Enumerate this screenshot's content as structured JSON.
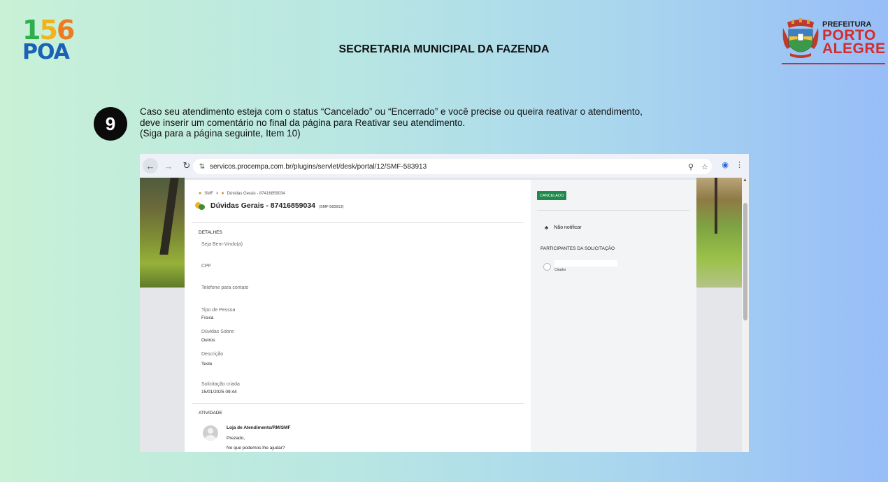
{
  "header": {
    "logo_156": {
      "digits": [
        "1",
        "5",
        "6"
      ],
      "bottom": "POA",
      "colors": [
        "#2fae4e",
        "#f2b21b",
        "#ee7b22",
        "#1a62b8"
      ]
    },
    "title": "SECRETARIA MUNICIPAL DA FAZENDA",
    "prefeitura": {
      "line1": "PREFEITURA",
      "line2": "PORTO",
      "line3": "ALEGRE",
      "accent": "#d22c2c",
      "crest_icon": "city-crest-icon"
    }
  },
  "step": {
    "number": "9",
    "lines": [
      "Caso seu atendimento esteja com o status “Cancelado” ou “Encerrado” e você precise ou queira reativar o atendimento,",
      "deve inserir um comentário no final da página para Reativar seu atendimento.",
      "(Siga para a página seguinte, Item 10)"
    ]
  },
  "browser": {
    "url": "servicos.procempa.com.br/plugins/servlet/desk/portal/12/SMF-583913",
    "icons": [
      "back-arrow-icon",
      "forward-arrow-icon",
      "reload-icon",
      "site-settings-icon",
      "zoom-icon",
      "star-icon",
      "profile-icon",
      "menu-icon"
    ]
  },
  "portal": {
    "breadcrumb": {
      "root": "SMF",
      "separator": ">",
      "current": "Dúvidas Gerais - 87416859034"
    },
    "request": {
      "title": "Dúvidas Gerais - 87416859034",
      "key": "(SMF-583913)"
    },
    "details_label": "DETALHES",
    "fields": [
      {
        "label": "Seja Bem-Vindo(a)",
        "value": ""
      },
      {
        "label": "CPF",
        "value": ""
      },
      {
        "label": "Telefone para contato",
        "value": ""
      },
      {
        "label": "Tipo de Pessoa",
        "value": "Física"
      },
      {
        "label": "Dúvidas Sobre:",
        "value": "Outros"
      },
      {
        "label": "Descrição",
        "value": "Teste"
      },
      {
        "label": "Solicitação criada",
        "value": "15/01/2025 09:44"
      }
    ],
    "activity_label": "ATIVIDADE",
    "activity": {
      "author": "Loja de Atendimento/RM/SMF",
      "lines": [
        "Prezado,",
        "No que podemos lhe ajudar?"
      ]
    },
    "sidebar": {
      "status": "CANCELADO",
      "status_color": "#1f8a4c",
      "notify_label": "Não notificar",
      "participants_title": "PARTICIPANTES DA SOLICITAÇÃO",
      "participant_role": "Criador"
    }
  }
}
